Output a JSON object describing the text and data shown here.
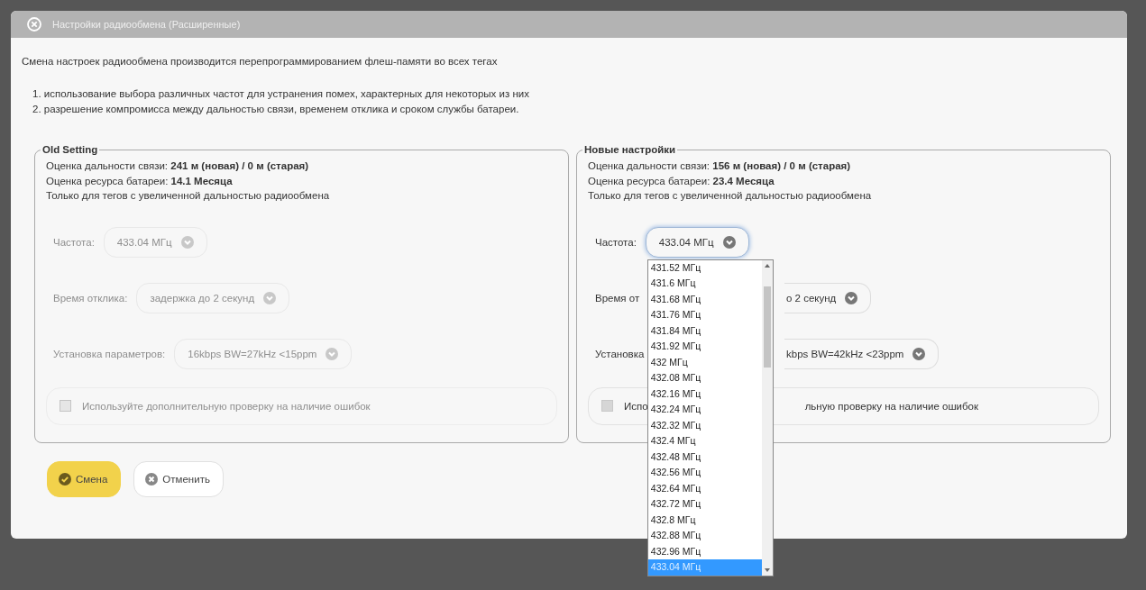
{
  "dialog": {
    "title": "Настройки радиообмена (Расширенные)"
  },
  "intro": "Смена настроек радиообмена производится перепрограммированием флеш-памяти во всех тегах",
  "reasons": [
    {
      "number": "1.",
      "text": "использование выбора различных частот для устранения помех, характерных для некоторых из них"
    },
    {
      "number": "2.",
      "text": "разрешение компромисса между дальностью связи, временем отклика и сроком службы батареи."
    }
  ],
  "panels": [
    {
      "legend": "Old Setting",
      "disabled": true,
      "range": "Оценка дальности связи: **241 м (новая) / 0 м (старая)**",
      "battery": "Оценка ресурса батареи: **14.1 Месяца**",
      "note": "Только для тегов с увеличенной дальностью радиообмена",
      "fields": [
        {
          "kind": "select",
          "label": "Частота:",
          "value": "433.04 МГц",
          "focused": false,
          "covered": false
        },
        {
          "kind": "select",
          "label": "Время отклика:",
          "value": "задержка до 2 секунд",
          "focused": false,
          "covered": false
        },
        {
          "kind": "select",
          "label": "Установка параметров:",
          "value": "16kbps BW=27kHz <15ppm",
          "focused": false,
          "covered": false
        },
        {
          "kind": "checkbox",
          "label": "Используйте дополнительную проверку на наличие ошибок",
          "checked": false
        }
      ]
    },
    {
      "legend": "Новые настройки",
      "disabled": false,
      "range": "Оценка дальности связи: **156 м (новая) / 0 м (старая)**",
      "battery": "Оценка ресурса батареи: **23.4 Месяца**",
      "note": "Только для тегов с увеличенной дальностью радиообмена",
      "fields": [
        {
          "kind": "select",
          "label": "Частота:",
          "value": "433.04 МГц",
          "focused": true,
          "covered": false,
          "options": [
            {
              "label": "431.52 МГц",
              "selected": false
            },
            {
              "label": "431.6 МГц",
              "selected": false
            },
            {
              "label": "431.68 МГц",
              "selected": false
            },
            {
              "label": "431.76 МГц",
              "selected": false
            },
            {
              "label": "431.84 МГц",
              "selected": false
            },
            {
              "label": "431.92 МГц",
              "selected": false
            },
            {
              "label": "432 МГц",
              "selected": false
            },
            {
              "label": "432.08 МГц",
              "selected": false
            },
            {
              "label": "432.16 МГц",
              "selected": false
            },
            {
              "label": "432.24 МГц",
              "selected": false
            },
            {
              "label": "432.32 МГц",
              "selected": false
            },
            {
              "label": "432.4 МГц",
              "selected": false
            },
            {
              "label": "432.48 МГц",
              "selected": false
            },
            {
              "label": "432.56 МГц",
              "selected": false
            },
            {
              "label": "432.64 МГц",
              "selected": false
            },
            {
              "label": "432.72 МГц",
              "selected": false
            },
            {
              "label": "432.8 МГц",
              "selected": false
            },
            {
              "label": "432.88 МГц",
              "selected": false
            },
            {
              "label": "432.96 МГц",
              "selected": false
            },
            {
              "label": "433.04 МГц",
              "selected": true
            }
          ]
        },
        {
          "kind": "select",
          "label": "Время от",
          "value": "о 2 секунд",
          "focused": false,
          "covered": true
        },
        {
          "kind": "select",
          "label": "Установка",
          "value": "kbps BW=42kHz <23ppm",
          "focused": false,
          "covered": true
        },
        {
          "kind": "checkbox",
          "label": "Испо",
          "label_end": "льную проверку на наличие ошибок",
          "checked": false
        }
      ]
    }
  ],
  "buttons": [
    {
      "kind": "primary",
      "label": "Смена"
    },
    {
      "kind": "secondary",
      "label": "Отменить"
    }
  ]
}
